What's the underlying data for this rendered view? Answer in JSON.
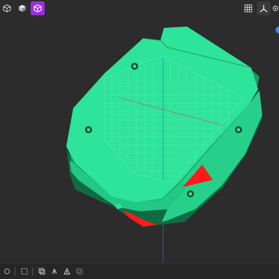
{
  "toolbar_left": [
    {
      "name": "view-cube-icon"
    },
    {
      "name": "solid-cube-icon"
    },
    {
      "name": "wireframe-cube-icon",
      "active": true
    }
  ],
  "toolbar_right": [
    {
      "name": "grid-layout-icon"
    },
    {
      "name": "axes-icon",
      "active": true
    },
    {
      "name": "settings-icon"
    }
  ],
  "bottom_toolbar": [
    {
      "name": "select-tool-icon"
    },
    {
      "name": "box-select-icon"
    },
    {
      "name": "copy-icon"
    },
    {
      "name": "move-icon"
    },
    {
      "name": "measure-icon"
    },
    {
      "name": "duplicate-icon"
    }
  ],
  "colors": {
    "background": "#2c2c2c",
    "model_top": "#2ee39a",
    "model_side": "#1a9e63",
    "model_dark": "#0f6b42",
    "highlight": "#ff1a1a",
    "accent": "#9b2fe0",
    "gizmo_blue": "#2d8cf0"
  }
}
